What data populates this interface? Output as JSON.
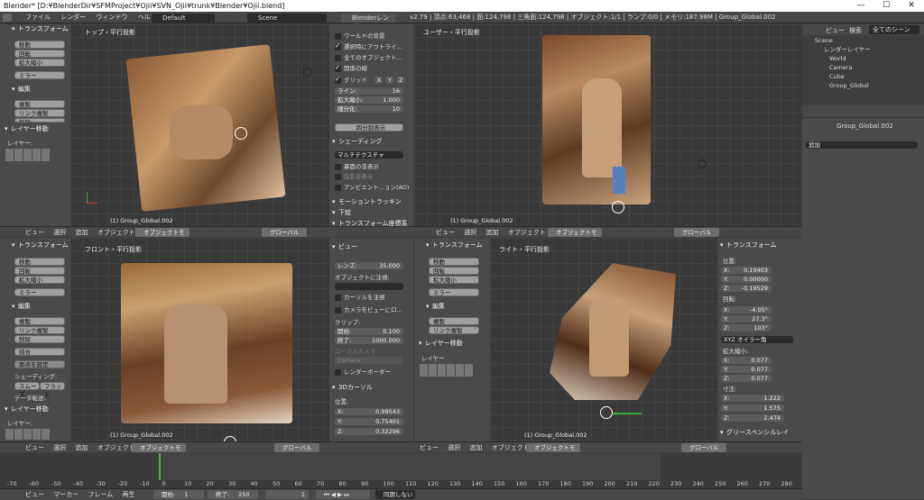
{
  "window": {
    "title": "Blender* [D:¥BlenderDir¥SFMProject¥Ojii¥SVN_Ojii¥trunk¥Blender¥Ojii.blend]",
    "min": "—",
    "max": "☐",
    "close": "✕"
  },
  "menubar": {
    "items": [
      "ファイル",
      "レンダー",
      "ウィンドウ",
      "ヘルプ"
    ],
    "layout": "Default",
    "scene": "Scene",
    "engine": "Blenderレンダー",
    "stats": "v2.79 | 頂点:63,468 | 面:124,798 | 三角面:124,798 | オブジェクト:1/1 | ランプ:0/0 | メモリ:187.98M | Group_Global.002"
  },
  "toolshelf_top": {
    "transform": "トランスフォーム",
    "buttons": [
      "移動",
      "回転",
      "拡大縮小",
      "ミラー"
    ],
    "edit": "編集",
    "edit_buttons": [
      "複製",
      "リンク複製",
      "削除"
    ],
    "layer_move": "レイヤー移動",
    "layer": "レイヤー:"
  },
  "toolshelf_bl": {
    "transform": "トランスフォーム",
    "buttons": [
      "移動",
      "回転",
      "拡大縮小",
      "ミラー"
    ],
    "edit": "編集",
    "edit_buttons": [
      "複製",
      "リンク複製",
      "削除",
      "結合"
    ],
    "origin": "原点を設定",
    "shading": "シェーディング:",
    "smooth": "スムーズ",
    "flat": "フラット",
    "data_transfer": "データ転送:",
    "layer_move": "レイヤー移動",
    "layer": "レイヤー:"
  },
  "toolshelf_br": {
    "transform": "トランスフォーム",
    "buttons": [
      "移動",
      "回転",
      "拡大縮小",
      "ミラー"
    ],
    "edit": "編集",
    "edit_buttons": [
      "複製",
      "リンク複製"
    ],
    "layer_move": "レイヤー移動",
    "layer": "レイヤー"
  },
  "views": {
    "tl": {
      "label": "トップ・平行投影",
      "object": "(1) Group_Global.002"
    },
    "tr": {
      "label": "ユーザー・平行投影",
      "object": "(1) Group_Global.002"
    },
    "bl": {
      "label": "フロント・平行投影",
      "object": "(1) Group_Global.002"
    },
    "br": {
      "label": "ライト・平行投影",
      "object": "(1) Group_Global.002"
    }
  },
  "view_header": {
    "items": [
      "ビュー",
      "選択",
      "追加",
      "オブジェクト"
    ],
    "mode": "オブジェクトモード",
    "orient": "グローバル"
  },
  "npanel_tl": {
    "rows": [
      "ワールドの背景",
      "選択時にアウトライ...",
      "全てのオブジェクト...",
      "関係の線"
    ],
    "grid": "グリッド",
    "axes": [
      "X",
      "Y",
      "Z"
    ],
    "lines_label": "ライン:",
    "lines": "16",
    "scale_label": "拡大縮小:",
    "scale": "1.000",
    "subdiv_label": "細分化:",
    "subdiv": "10",
    "quad": "四分割表示",
    "shading": "シェーディング",
    "matcap": "マルチテクスチャ",
    "bg": "裏面の非表示",
    "hidden": "陰影非表示",
    "ao": "アンビエント...ョン(AO)",
    "motion": "モーショントラッキン",
    "dof": "下絵",
    "transform": "トランスフォーム座標系"
  },
  "npanel_bl": {
    "view": "ビュー",
    "lens_label": "レンズ:",
    "lens": "35.000",
    "lock": "オブジェクトに注視:",
    "cursor": "カーソルを注視",
    "camera": "カメラをビューにロ...",
    "clip": "クリップ:",
    "start_label": "開始:",
    "start": "0.100",
    "end_label": "終了:",
    "end": "1000.000",
    "local_cam": "ローカルカメラ:",
    "cam_name": "Camera",
    "render_border": "レンダーボーダー",
    "cursor3d": "3Dカーソル",
    "pos": "位置:",
    "x_label": "X:",
    "x": "0.99543",
    "y_label": "Y:",
    "y": "0.75401",
    "z_label": "Z:",
    "z": "0.32296"
  },
  "npanel_br": {
    "transform": "トランスフォーム",
    "loc": "位置:",
    "lx": "0.19403",
    "ly": "0.00000",
    "lz": "-0.19529",
    "rot": "回転:",
    "rx": "-4.05°",
    "ry": "27.3°",
    "rz": "103°",
    "rot_mode": "XYZ オイラー角",
    "scale": "拡大縮小:",
    "sx": "0.077",
    "sy": "0.077",
    "sz": "0.077",
    "dim": "寸法:",
    "dx": "1.222",
    "dy": "1.575",
    "dz": "2.474",
    "gp": "グリースペンシルレイ"
  },
  "outliner": {
    "view": "ビュー",
    "search": "検索",
    "filter": "全てのシーン",
    "items": [
      "Scene",
      "レンダーレイヤー",
      "World",
      "Camera",
      "Cube",
      "Group_Global"
    ]
  },
  "properties": {
    "object": "Group_Global.002",
    "add": "追加"
  },
  "timeline": {
    "ticks": [
      "-70",
      "-60",
      "-50",
      "-40",
      "-30",
      "-20",
      "-10",
      "0",
      "10",
      "20",
      "30",
      "40",
      "50",
      "60",
      "70",
      "80",
      "90",
      "100",
      "110",
      "120",
      "130",
      "140",
      "150",
      "160",
      "170",
      "180",
      "190",
      "200",
      "210",
      "220",
      "230",
      "240",
      "250",
      "260",
      "270",
      "280"
    ],
    "menu": [
      "ビュー",
      "マーカー",
      "フレーム",
      "再生"
    ],
    "start_label": "開始:",
    "start": "1",
    "end_label": "終了:",
    "end": "250",
    "current": "1",
    "sync": "同期しない"
  },
  "colors": {
    "accent": "#5680c2",
    "bg": "#393939",
    "panel": "#4a4a4a"
  }
}
